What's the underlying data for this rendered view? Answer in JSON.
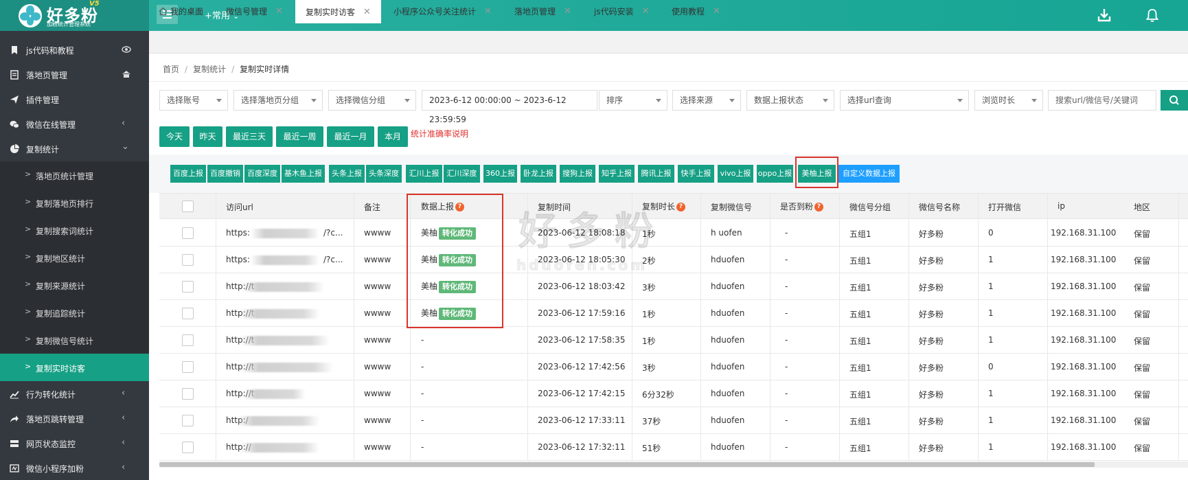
{
  "header": {
    "logo_text": "好多粉",
    "logo_sub": "加粉统计管理系统",
    "logo_version": "V5",
    "common_menu": "+常用"
  },
  "sidebar": {
    "items": [
      {
        "label": "js代码和教程",
        "icon": "bookmark-icon"
      },
      {
        "label": "落地页管理",
        "icon": "document-icon"
      },
      {
        "label": "插件管理",
        "icon": "send-icon"
      },
      {
        "label": "微信在线管理",
        "icon": "wechat-icon"
      },
      {
        "label": "复制统计",
        "icon": "pie-chart-icon"
      }
    ],
    "sub_items": [
      {
        "label": "落地页统计管理"
      },
      {
        "label": "复制落地页排行"
      },
      {
        "label": "复制搜索词统计"
      },
      {
        "label": "复制地区统计"
      },
      {
        "label": "复制来源统计"
      },
      {
        "label": "复制追踪统计"
      },
      {
        "label": "复制微信号统计"
      },
      {
        "label": "复制实时访客"
      }
    ],
    "bottom_items": [
      {
        "label": "行为转化统计",
        "icon": "line-chart-icon"
      },
      {
        "label": "落地页跳转管理",
        "icon": "share-icon"
      },
      {
        "label": "网页状态监控",
        "icon": "server-icon"
      },
      {
        "label": "微信小程序加粉",
        "icon": "miniprogram-icon"
      }
    ]
  },
  "tabs": [
    {
      "label": "我的桌面"
    },
    {
      "label": "微信号管理"
    },
    {
      "label": "复制实时访客"
    },
    {
      "label": "小程序公众号关注统计"
    },
    {
      "label": "落地页管理"
    },
    {
      "label": "js代码安装"
    },
    {
      "label": "使用教程"
    }
  ],
  "breadcrumb": [
    "首页",
    "复制统计",
    "复制实时详情"
  ],
  "filters": {
    "account": "选择账号",
    "landing_group": "选择落地页分组",
    "wechat_group": "选择微信分组",
    "date_range": "2023-6-12 00:00:00 ~ 2023-6-12 23:59:59",
    "sort": "排序",
    "source": "选择来源",
    "report_status": "数据上报状态",
    "url_query": "选择url查询",
    "browse_time": "浏览时长",
    "search_placeholder": "搜索url/微信号/关键词"
  },
  "date_buttons": [
    "今天",
    "昨天",
    "最近三天",
    "最近一周",
    "最近一月",
    "本月"
  ],
  "accuracy_note": "统计准确率说明",
  "report_buttons": [
    "百度上报",
    "百度撤销",
    "百度深度",
    "基木鱼上报",
    "头条上报",
    "头条深度",
    "汇川上报",
    "汇川深度",
    "360上报",
    "卧龙上报",
    "搜狗上报",
    "知乎上报",
    "腾讯上报",
    "快手上报",
    "vivo上报",
    "oppo上报",
    "美柚上报",
    "自定义数据上报"
  ],
  "table": {
    "columns": [
      "访问url",
      "备注",
      "数据上报",
      "复制时间",
      "复制时长",
      "复制微信号",
      "是否到粉",
      "微信号分组",
      "微信号名称",
      "打开微信",
      "ip",
      "地区"
    ],
    "rows": [
      {
        "url": "https:",
        "url_end": "/?c...",
        "note": "wwww",
        "report": "美柚",
        "report_badge": "转化成功",
        "time": "2023-06-12 18:08:18",
        "duration": "1秒",
        "wechat": "h    uofen",
        "arrived": "-",
        "group": "五组1",
        "name": "好多粉",
        "open": "0",
        "ip": "192.168.31.100",
        "region": "保留"
      },
      {
        "url": "https:",
        "url_end": "/?c...",
        "note": "wwww",
        "report": "美柚",
        "report_badge": "转化成功",
        "time": "2023-06-12 18:05:30",
        "duration": "2秒",
        "wechat": "hduofen",
        "arrived": "-",
        "group": "五组1",
        "name": "好多粉",
        "open": "1",
        "ip": "192.168.31.100",
        "region": "保留"
      },
      {
        "url": "http://t",
        "url_end": "",
        "note": "wwww",
        "report": "美柚",
        "report_badge": "转化成功",
        "time": "2023-06-12 18:03:42",
        "duration": "3秒",
        "wechat": "hduofen",
        "arrived": "-",
        "group": "五组1",
        "name": "好多粉",
        "open": "1",
        "ip": "192.168.31.100",
        "region": "保留"
      },
      {
        "url": "http://t",
        "url_end": "",
        "note": "wwww",
        "report": "美柚",
        "report_badge": "转化成功",
        "time": "2023-06-12 17:59:16",
        "duration": "1秒",
        "wechat": "hduofen",
        "arrived": "-",
        "group": "五组1",
        "name": "好多粉",
        "open": "1",
        "ip": "192.168.31.100",
        "region": "保留"
      },
      {
        "url": "http://t",
        "url_end": "",
        "note": "wwww",
        "report": "-",
        "report_badge": "",
        "time": "2023-06-12 17:58:35",
        "duration": "1秒",
        "wechat": "hduofen",
        "arrived": "-",
        "group": "五组1",
        "name": "好多粉",
        "open": "1",
        "ip": "192.168.31.100",
        "region": "保留"
      },
      {
        "url": "http://t",
        "url_end": "",
        "note": "wwww",
        "report": "-",
        "report_badge": "",
        "time": "2023-06-12 17:42:56",
        "duration": "3秒",
        "wechat": "hduofen",
        "arrived": "-",
        "group": "五组1",
        "name": "好多粉",
        "open": "0",
        "ip": "192.168.31.100",
        "region": "保留"
      },
      {
        "url": "http://t",
        "url_end": "",
        "note": "wwww",
        "report": "-",
        "report_badge": "",
        "time": "2023-06-12 17:42:15",
        "duration": "6分32秒",
        "wechat": "hduofen",
        "arrived": "-",
        "group": "五组1",
        "name": "好多粉",
        "open": "1",
        "ip": "192.168.31.100",
        "region": "保留"
      },
      {
        "url": "http:/",
        "url_end": "",
        "note": "wwww",
        "report": "-",
        "report_badge": "",
        "time": "2023-06-12 17:33:11",
        "duration": "37秒",
        "wechat": "hduofen",
        "arrived": "-",
        "group": "五组1",
        "name": "好多粉",
        "open": "1",
        "ip": "192.168.31.100",
        "region": "保留"
      },
      {
        "url": "http://",
        "url_end": "",
        "note": "wwww",
        "report": "-",
        "report_badge": "",
        "time": "2023-06-12 17:32:11",
        "duration": "51秒",
        "wechat": "hduofen",
        "arrived": "-",
        "group": "五组1",
        "name": "好多粉",
        "open": "1",
        "ip": "192.168.31.100",
        "region": "保留"
      }
    ]
  },
  "watermark": {
    "main": "好多粉",
    "sub": "hduofen.com"
  },
  "colors": {
    "accent": "#16a085",
    "sidebar_bg": "#34393f",
    "highlight_red": "#d9342b",
    "badge_green": "#5fb878",
    "blue_btn": "#1e9fff"
  }
}
